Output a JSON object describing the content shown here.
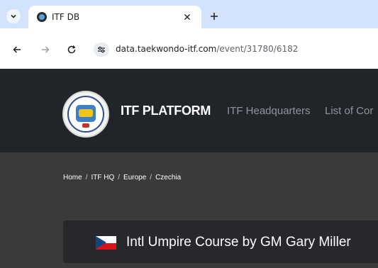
{
  "browser": {
    "tab": {
      "title": "ITF DB",
      "favicon": "itf-favicon"
    },
    "address_bar": {
      "domain": "data.taekwondo-itf.com",
      "path": "/event/31780/6182"
    },
    "colors": {
      "tabstrip": "#d3e3fd",
      "toolbar": "#ffffff"
    }
  },
  "site": {
    "brand": "ITF PLATFORM",
    "nav": [
      "ITF Headquarters",
      "List of Cor"
    ],
    "breadcrumb": [
      "Home",
      "ITF HQ",
      "Europe",
      "Czechia"
    ],
    "breadcrumb_separator": "/",
    "event": {
      "title": "Intl Umpire Course by GM Gary Miller",
      "flag": "czech-flag-icon"
    },
    "colors": {
      "header": "#212529",
      "band": "#3a3a3a",
      "card": "#26282c",
      "nav_link": "#8f959b"
    }
  }
}
